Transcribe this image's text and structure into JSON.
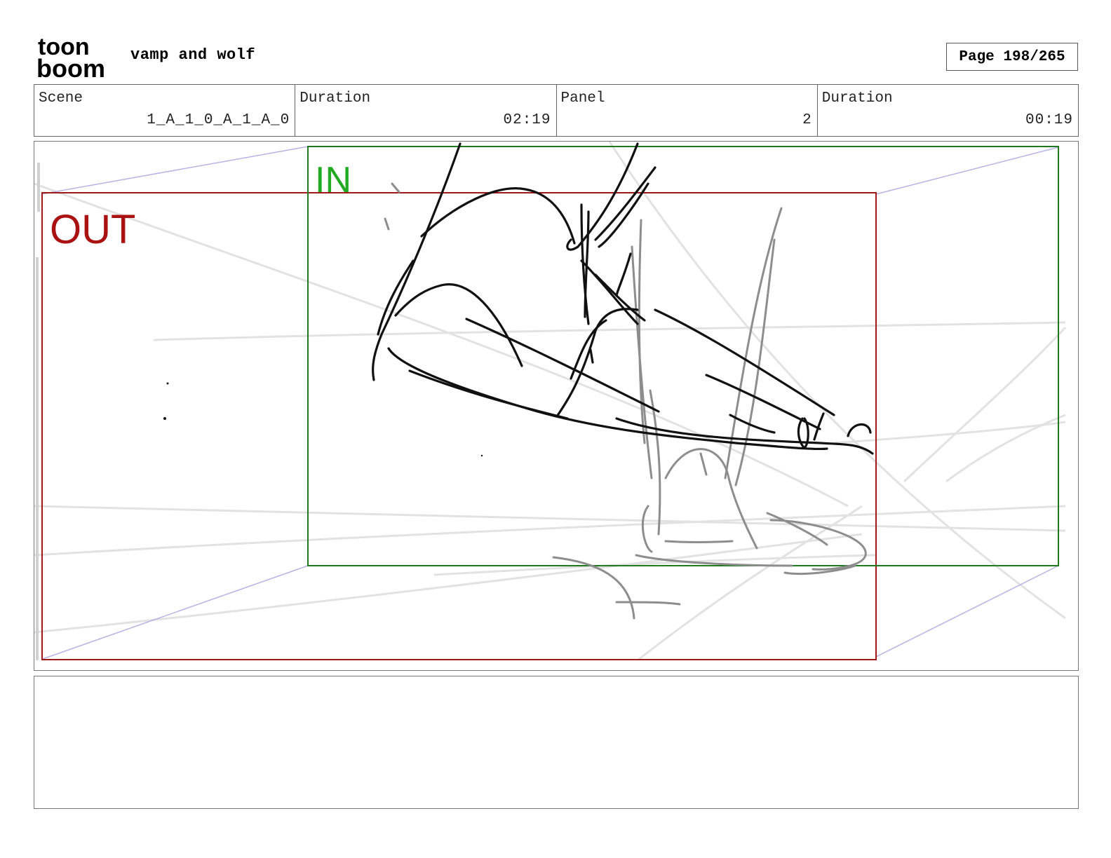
{
  "header": {
    "logo_text_top": "toon",
    "logo_text_bottom": "boom",
    "project_title": "vamp and wolf",
    "page_label": "Page 198/265"
  },
  "info": [
    {
      "label": "Scene",
      "value": "1_A_1_0_A_1_A_0"
    },
    {
      "label": "Duration",
      "value": "02:19"
    },
    {
      "label": "Panel",
      "value": "2"
    },
    {
      "label": "Duration",
      "value": "00:19"
    }
  ],
  "panel": {
    "in_label": "IN",
    "out_label": "OUT",
    "colors": {
      "in_frame": "#1f7a1f",
      "in_text": "#22aa22",
      "out_frame": "#a01818",
      "out_text": "#aa1111"
    }
  },
  "notes": {
    "text": ""
  }
}
